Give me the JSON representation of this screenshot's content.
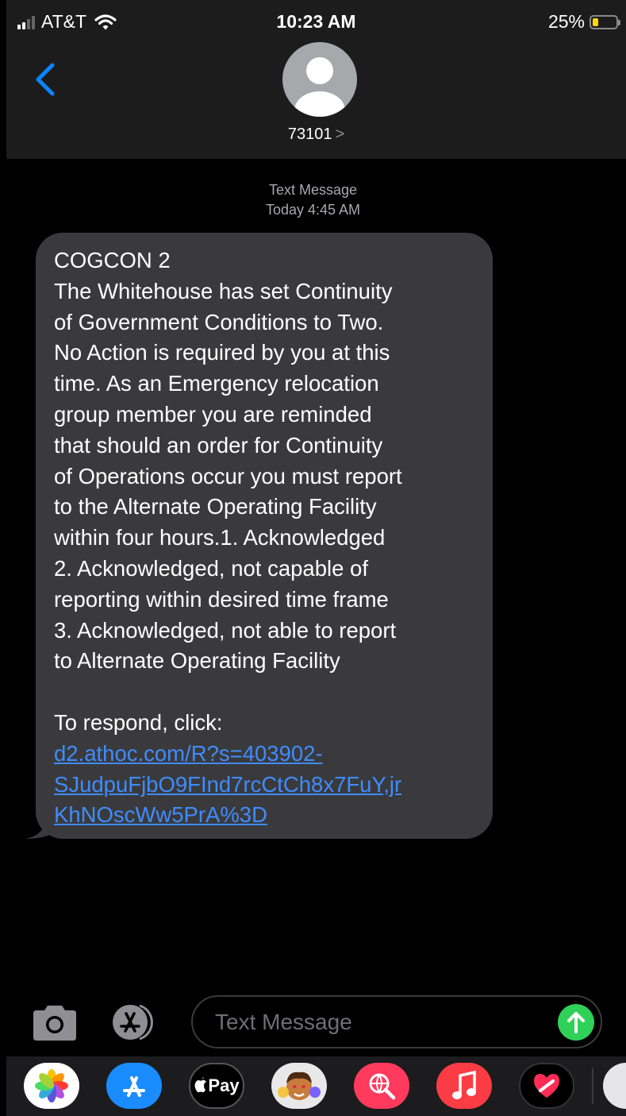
{
  "status_bar": {
    "carrier": "AT&T",
    "time": "10:23 AM",
    "battery_percent": "25%",
    "battery_level": 0.25,
    "colors": {
      "battery": "#ffd60a"
    }
  },
  "header": {
    "back_icon": "chevron-left-icon",
    "contact_number": "73101",
    "contact_chevron": ">",
    "avatar_icon": "person-silhouette-icon"
  },
  "thread": {
    "message_type": "Text Message",
    "timestamp": "Today 4:45 AM",
    "message": {
      "body": "COGCON 2\nThe Whitehouse has set Continuity\nof Government Conditions to Two.\nNo Action is required by you at this\ntime.  As an Emergency relocation\ngroup member you are reminded\nthat should an order for Continuity\nof Operations occur you must report\nto the Alternate Operating Facility\nwithin four hours.1. Acknowledged\n2. Acknowledged, not capable of\nreporting within desired time frame\n3. Acknowledged, not able to report\nto Alternate Operating Facility\n\nTo respond, click:",
      "link": "d2.athoc.com/R?s=403902-\nSJudpuFjbO9FInd7rcCtCh8x7FuY,jr\nKhNOscWw5PrA%3D"
    }
  },
  "compose": {
    "placeholder": "Text Message",
    "value": "",
    "camera_icon": "camera-icon",
    "apps_icon": "app-store-icon",
    "send_icon": "arrow-up-icon",
    "colors": {
      "send": "#30d158"
    }
  },
  "app_drawer": {
    "apps": [
      {
        "name": "photos",
        "icon": "photos-icon"
      },
      {
        "name": "app-store",
        "icon": "app-store-icon"
      },
      {
        "name": "apple-pay",
        "label": "Pay",
        "icon": "apple-pay-icon"
      },
      {
        "name": "memoji",
        "icon": "memoji-icon"
      },
      {
        "name": "images-search",
        "icon": "globe-search-icon"
      },
      {
        "name": "music",
        "icon": "music-note-icon"
      },
      {
        "name": "digital-touch",
        "icon": "heart-touch-icon"
      }
    ]
  }
}
